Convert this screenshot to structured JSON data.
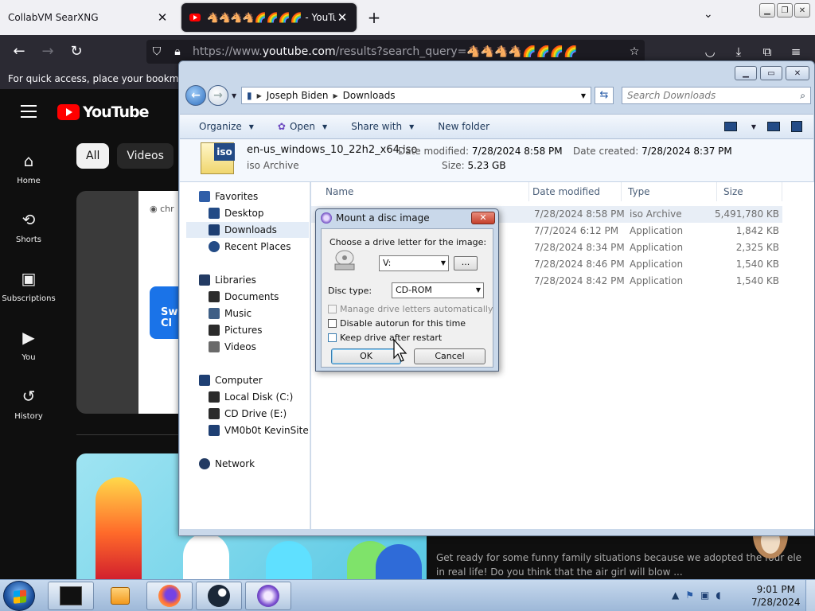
{
  "browser": {
    "tabs": [
      {
        "title": "CollabVM SearXNG",
        "active": false
      },
      {
        "title": "🐴🐴🐴🐴🌈🌈🌈🌈 - YouTube",
        "active": true
      }
    ],
    "url_prefix": "https://www.",
    "url_domain": "youtube.com",
    "url_rest": "/results?search_query=🐴🐴🐴🐴🌈🌈🌈🌈",
    "bookmarks_hint": "For quick access, place your bookmarks h"
  },
  "youtube": {
    "logo_text": "YouTube",
    "sidebar": [
      {
        "label": "Home",
        "icon": "⌂"
      },
      {
        "label": "Shorts",
        "icon": "⟲"
      },
      {
        "label": "Subscriptions",
        "icon": "▣"
      },
      {
        "label": "You",
        "icon": "▶"
      },
      {
        "label": "History",
        "icon": "↺"
      }
    ],
    "chips": [
      "All",
      "Videos"
    ],
    "thumb1_text": "chr",
    "thumb1_btn": "Sw\nCl",
    "video_desc_line1": "Get ready for some funny family situations because we adopted the four ele",
    "video_desc_line2": "in real life! Do you think that the air girl will blow ..."
  },
  "explorer": {
    "breadcrumb": [
      "Joseph Biden",
      "Downloads"
    ],
    "search_placeholder": "Search Downloads",
    "commands": [
      "Organize",
      "Open",
      "Share with",
      "New folder"
    ],
    "details": {
      "name": "en-us_windows_10_22h2_x64.iso",
      "type": "iso Archive",
      "modified_label": "Date modified:",
      "modified": "7/28/2024 8:58 PM",
      "size_label": "Size:",
      "size": "5.23 GB",
      "created_label": "Date created:",
      "created": "7/28/2024 8:37 PM",
      "icon_text": "iso"
    },
    "nav": {
      "favorites": "Favorites",
      "desktop": "Desktop",
      "downloads": "Downloads",
      "recent": "Recent Places",
      "libraries": "Libraries",
      "documents": "Documents",
      "music": "Music",
      "pictures": "Pictures",
      "videos": "Videos",
      "computer": "Computer",
      "local_disk": "Local Disk (C:)",
      "cd_drive": "CD Drive (E:)",
      "vm": "VM0b0t KevinSite",
      "network": "Network"
    },
    "columns": [
      "Name",
      "Date modified",
      "Type",
      "Size"
    ],
    "files": [
      {
        "modified": "7/28/2024 8:58 PM",
        "type": "iso Archive",
        "size": "5,491,780 KB"
      },
      {
        "modified": "7/7/2024 6:12 PM",
        "type": "Application",
        "size": "1,842 KB"
      },
      {
        "modified": "7/28/2024 8:34 PM",
        "type": "Application",
        "size": "2,325 KB"
      },
      {
        "modified": "7/28/2024 8:46 PM",
        "type": "Application",
        "size": "1,540 KB"
      },
      {
        "modified": "7/28/2024 8:42 PM",
        "type": "Application",
        "size": "1,540 KB"
      }
    ]
  },
  "dialog": {
    "title": "Mount a disc image",
    "choose_label": "Choose a drive letter for the image:",
    "drive_value": "V:",
    "browse_label": "...",
    "disc_type_label": "Disc type:",
    "disc_type_value": "CD-ROM",
    "opt_manage": "Manage drive letters automatically",
    "opt_autorun": "Disable autorun for this time",
    "opt_keep": "Keep drive after restart",
    "ok": "OK",
    "cancel": "Cancel"
  },
  "taskbar": {
    "time": "9:01 PM",
    "date": "7/28/2024"
  },
  "colors": {
    "yt_red": "#ff0000",
    "win_blue": "#234b86",
    "dialog_frame": "#c9d8ea"
  }
}
